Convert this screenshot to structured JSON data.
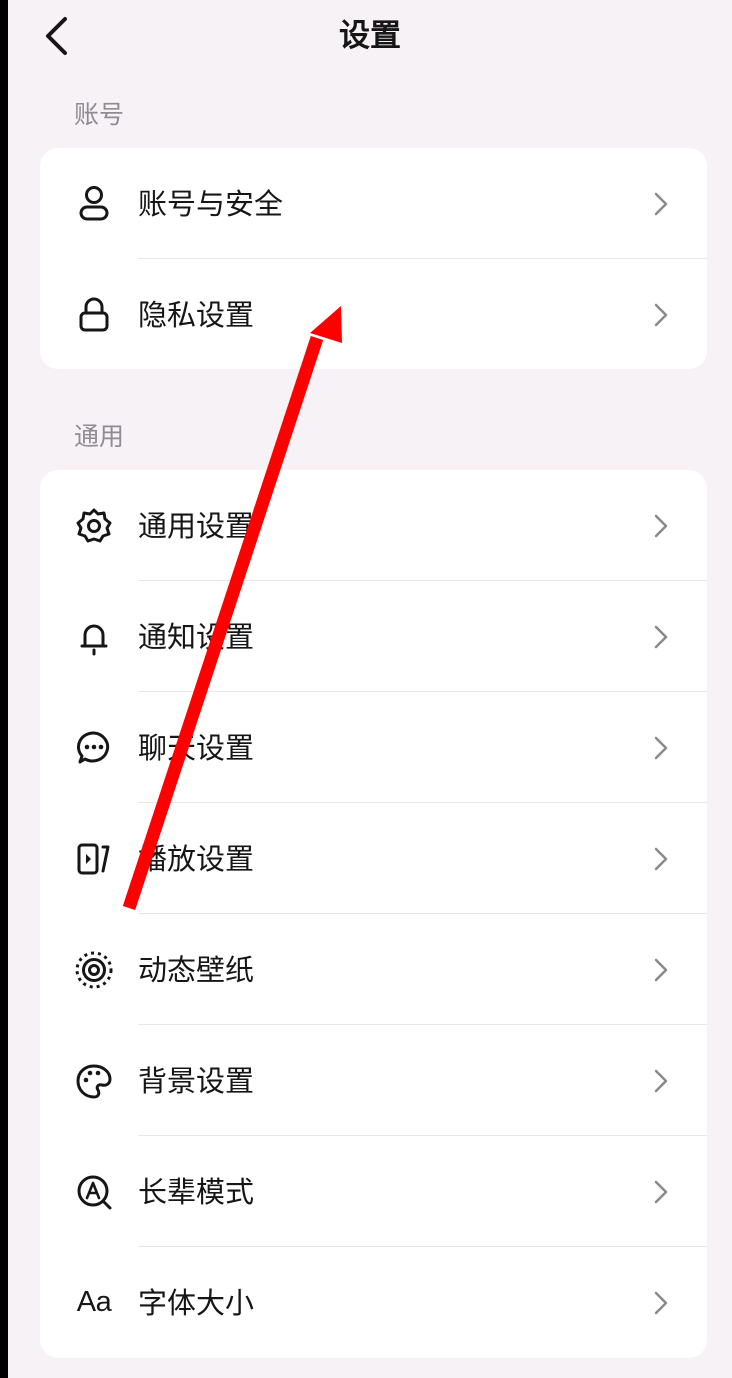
{
  "header": {
    "title": "设置"
  },
  "sections": [
    {
      "label": "账号",
      "items": [
        {
          "label": "账号与安全",
          "icon": "user-icon"
        },
        {
          "label": "隐私设置",
          "icon": "lock-icon"
        }
      ]
    },
    {
      "label": "通用",
      "items": [
        {
          "label": "通用设置",
          "icon": "gear-icon"
        },
        {
          "label": "通知设置",
          "icon": "bell-icon"
        },
        {
          "label": "聊天设置",
          "icon": "chat-bubble-icon"
        },
        {
          "label": "播放设置",
          "icon": "play-screen-icon"
        },
        {
          "label": "动态壁纸",
          "icon": "live-wallpaper-icon"
        },
        {
          "label": "背景设置",
          "icon": "palette-icon"
        },
        {
          "label": "长辈模式",
          "icon": "elder-mode-icon"
        },
        {
          "label": "字体大小",
          "icon": "font-size-icon",
          "icon_text": "Aa"
        }
      ]
    }
  ],
  "annotation": {
    "color": "#FF0000",
    "kind": "arrow"
  },
  "colors": {
    "background": "#F6F2F6",
    "card": "#FFFFFF",
    "text": "#161616",
    "muted": "#8F8C93",
    "chevron": "#8A8A8A"
  }
}
